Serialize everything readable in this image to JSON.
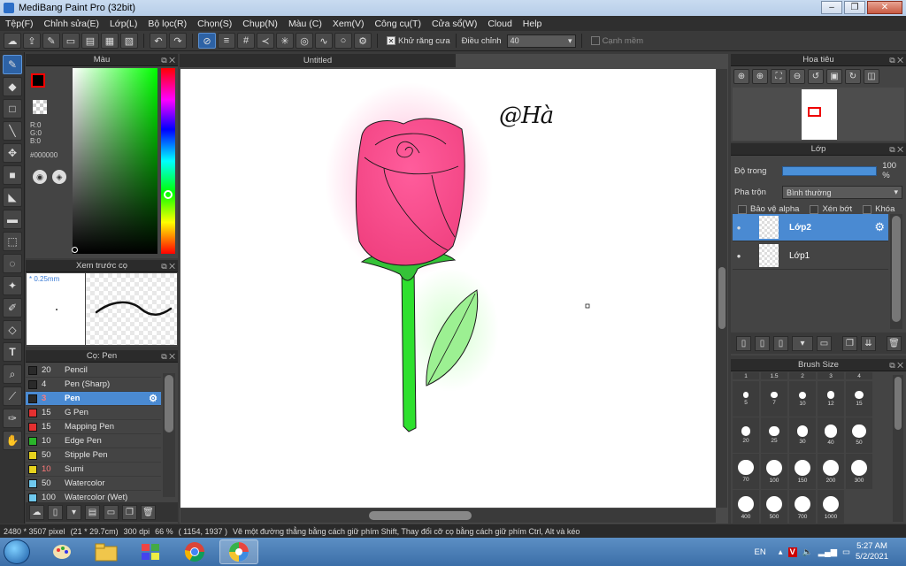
{
  "window": {
    "title": "MediBang Paint Pro (32bit)",
    "minimize": "–",
    "maximize": "❐",
    "close": "✕"
  },
  "menubar": {
    "items": [
      "Tệp(F)",
      "Chỉnh sửa(E)",
      "Lớp(L)",
      "Bộ lọc(R)",
      "Chọn(S)",
      "Chụp(N)",
      "Màu (C)",
      "Xem(V)",
      "Công cụ(T)",
      "Cửa sổ(W)",
      "Cloud",
      "Help"
    ]
  },
  "toolbar": {
    "antialias_label": "Khử răng cưa",
    "antialias_checked": true,
    "adjust_label": "Điều chỉnh",
    "adjust_value": "40",
    "soft_edge_label": "Cạnh mềm",
    "soft_edge_checked": false
  },
  "color_panel": {
    "title": "Màu",
    "r": "R:0",
    "g": "G:0",
    "b": "B:0",
    "hex": "#000000",
    "fg_color": "#000000",
    "fg_border": "#ff0000"
  },
  "brush_preview": {
    "title": "Xem trước cọ",
    "size": "0.25mm"
  },
  "brush_list": {
    "title": "Cọ: Pen",
    "items": [
      {
        "size": "20",
        "name": "Pencil",
        "color": "#2a2a2a",
        "selected": false
      },
      {
        "size": "4",
        "name": "Pen (Sharp)",
        "color": "#2a2a2a",
        "selected": false
      },
      {
        "size": "3",
        "name": "Pen",
        "color": "#2a2a2a",
        "selected": true
      },
      {
        "size": "15",
        "name": "G Pen",
        "color": "#e53030",
        "selected": false
      },
      {
        "size": "15",
        "name": "Mapping Pen",
        "color": "#e53030",
        "selected": false
      },
      {
        "size": "10",
        "name": "Edge Pen",
        "color": "#2ab52a",
        "selected": false
      },
      {
        "size": "50",
        "name": "Stipple Pen",
        "color": "#e6d21e",
        "selected": false
      },
      {
        "size": "10",
        "name": "Sumi",
        "color": "#e6d21e",
        "selected": false
      },
      {
        "size": "50",
        "name": "Watercolor",
        "color": "#6fc9ee",
        "selected": false
      },
      {
        "size": "100",
        "name": "Watercolor (Wet)",
        "color": "#6fc9ee",
        "selected": false
      }
    ]
  },
  "document": {
    "tab_title": "Untitled",
    "signature": "@Hà"
  },
  "navigator": {
    "title": "Hoa tiêu"
  },
  "layers": {
    "title": "Lớp",
    "opacity_label": "Độ trong",
    "opacity_value": "100 %",
    "opacity_fraction": 1.0,
    "blend_label": "Pha trộn",
    "blend_value": "Bình thường",
    "protect_alpha": "Bảo vệ alpha",
    "clipping": "Xén bớt",
    "lock": "Khóa",
    "items": [
      {
        "name": "Lớp2",
        "selected": true
      },
      {
        "name": "Lớp1",
        "selected": false
      }
    ]
  },
  "brush_size": {
    "title": "Brush Size",
    "sizes": [
      "1",
      "1.5",
      "2",
      "3",
      "4",
      "5",
      "7",
      "10",
      "12",
      "15",
      "20",
      "25",
      "30",
      "40",
      "50",
      "70",
      "100",
      "150",
      "200",
      "300",
      "400",
      "500",
      "700",
      "1000"
    ]
  },
  "status": {
    "dimensions": "2480 * 3507 pixel",
    "paper": "(21 * 29.7cm)",
    "dpi": "300 dpi",
    "zoom": "66 %",
    "cursor": "( 1154, 1937 )",
    "hint": "Vẽ một đường thẳng bằng cách giữ phím Shift, Thay đổi cỡ cọ bằng cách giữ phím Ctrl, Alt và kéo"
  },
  "taskbar": {
    "lang": "EN",
    "time": "5:27 AM",
    "date": "5/2/2021"
  }
}
